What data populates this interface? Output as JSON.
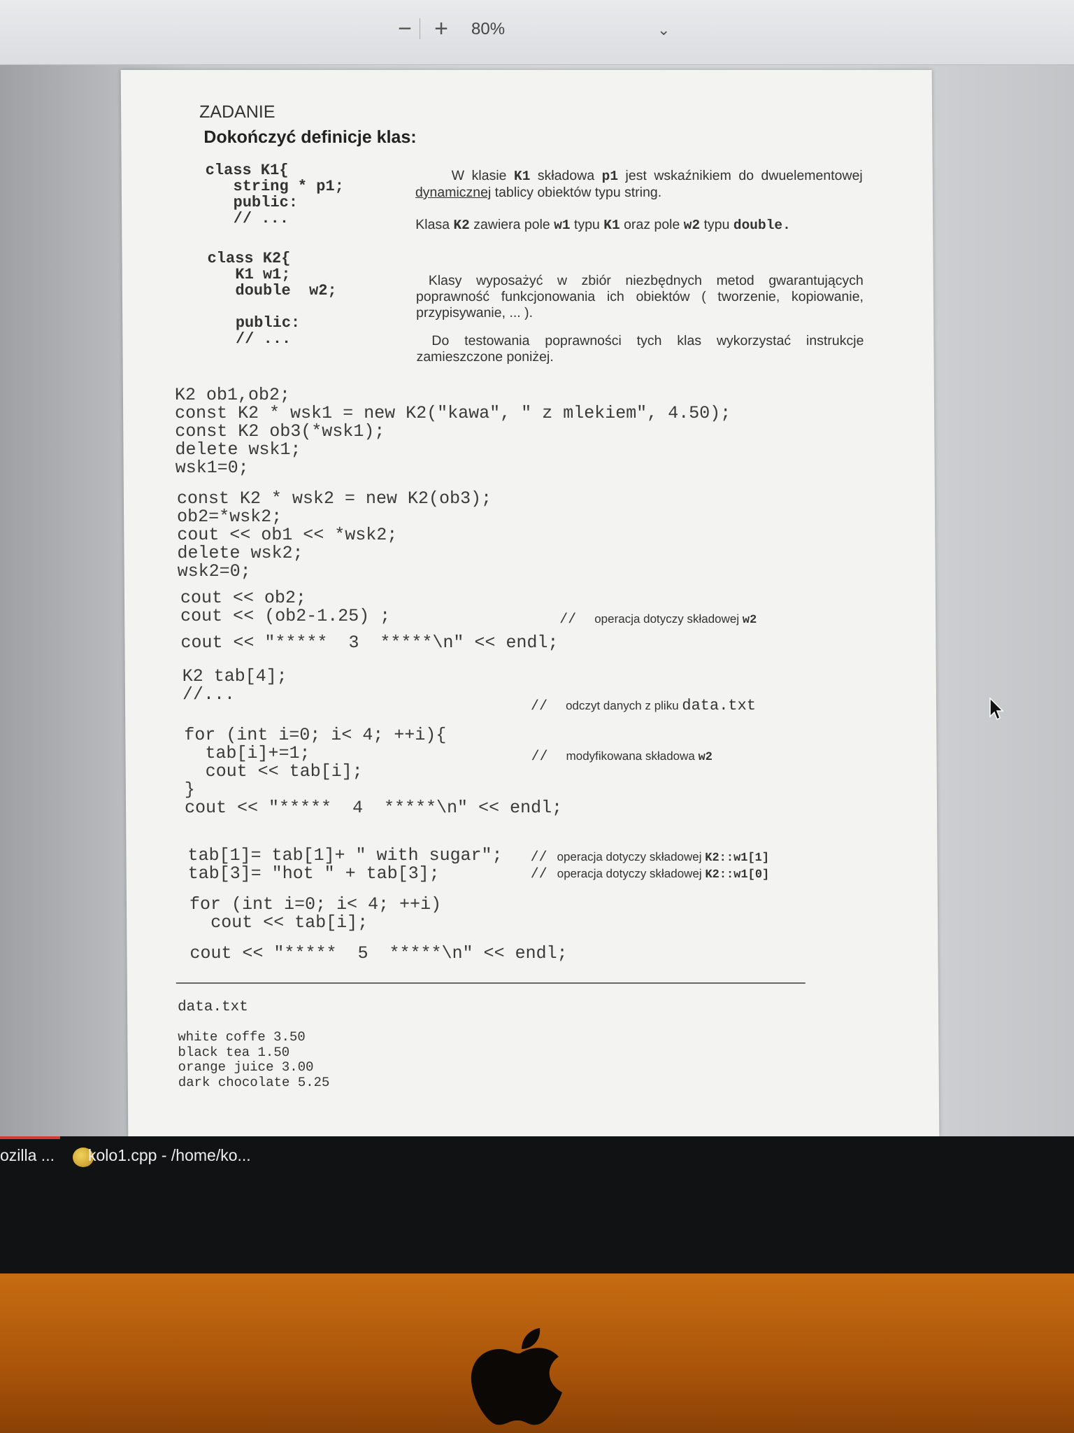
{
  "toolbar": {
    "zoom_out_label": "−",
    "zoom_in_label": "+",
    "zoom_value": "80%",
    "zoom_chevron": "⌄"
  },
  "document": {
    "heading": "ZADANIE",
    "subheading": "Dokończyć definicje klas:",
    "class_k1_code": "class K1{\n   string * p1;\n   public:\n   // ...",
    "class_k2_code": "class K2{\n   K1 w1;\n   double  w2;\n\n   public:\n   // ...",
    "desc1_pre": "W klasie ",
    "desc1_k1": "K1",
    "desc1_mid": " składowa ",
    "desc1_p1": "p1",
    "desc1_mid2": " jest wskaźnikiem do dwuelementowej ",
    "desc1_underline": "dynamicznej",
    "desc1_post": " tablicy obiektów typu string.",
    "desc2_pre": "Klasa ",
    "desc2_k2": "K2",
    "desc2_mid": " zawiera pole ",
    "desc2_w1": "w1",
    "desc2_mid2": " typu ",
    "desc2_k1": "K1",
    "desc2_mid3": " oraz pole ",
    "desc2_w2": "w2",
    "desc2_mid4": " typu ",
    "desc2_double": "double.",
    "desc3": "Klasy wyposażyć w zbiór niezbędnych metod gwarantujących poprawność funkcjonowania ich obiektów ( tworzenie, kopiowanie, przypisywanie, ... ).",
    "desc4": "Do testowania poprawności tych klas wykorzystać instrukcje zamieszczone poniżej.",
    "code_block1": "K2 ob1,ob2;\nconst K2 * wsk1 = new K2(\"kawa\", \" z mlekiem\", 4.50);\nconst K2 ob3(*wsk1);\ndelete wsk1;\nwsk1=0;",
    "code_block2": "const K2 * wsk2 = new K2(ob3);\nob2=*wsk2;\ncout << ob1 << *wsk2;\ndelete wsk2;\nwsk2=0;",
    "code_block3": "cout << ob2;\ncout << (ob2-1.25) ;",
    "code_line_3": "cout << \"*****  3  *****\\n\" << endl;",
    "code_block4": "K2 tab[4];\n//...",
    "code_block5": "for (int i=0; i< 4; ++i){\n  tab[i]+=1;\n  cout << tab[i];\n}\ncout << \"*****  4  *****\\n\" << endl;",
    "code_block6": "tab[1]= tab[1]+ \" with sugar\";\ntab[3]= \"hot \" + tab[3];",
    "code_block7": "for (int i=0; i< 4; ++i)\n  cout << tab[i];",
    "code_line_5": "cout << \"*****  5  *****\\n\" << endl;",
    "comment_w2_text": "operacja dotyczy składowej",
    "comment_w2_code": "w2",
    "comment_read_text": "odczyt danych z pliku",
    "comment_read_code": "data.txt",
    "comment_mod_text": "modyfikowana składowa",
    "comment_mod_code": "w2",
    "comment_w11_text": "operacja dotyczy składowej",
    "comment_w11_code": "K2::w1[1]",
    "comment_w10_text": "operacja dotyczy składowej",
    "comment_w10_code": "K2::w1[0]",
    "comment_slash": "//",
    "data_file_title": "data.txt",
    "data_file_lines": "white coffe 3.50\nblack tea 1.50\norange juice 3.00\ndark chocolate 5.25"
  },
  "taskbar": {
    "item1": "ozilla ...",
    "item2": "kolo1.cpp - /home/ko..."
  }
}
